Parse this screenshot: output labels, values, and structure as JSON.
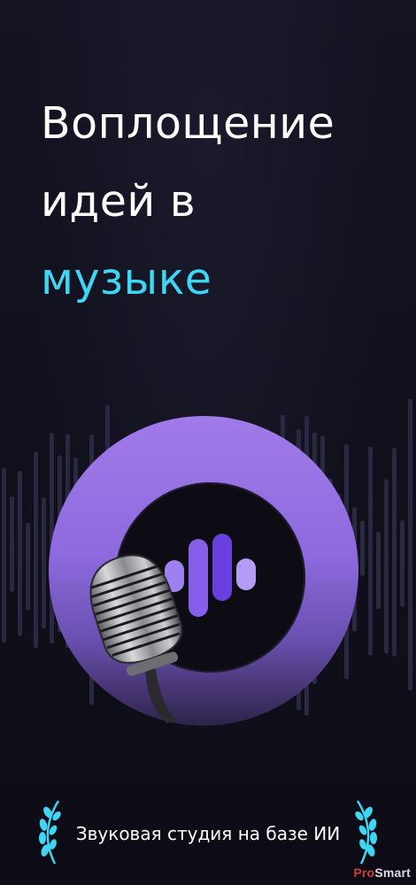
{
  "headline": {
    "line1": "Воплощение",
    "line2": "идей в",
    "line3": "музыке"
  },
  "tagline": "Звуковая студия на базе ИИ",
  "watermark": {
    "pro": "Pro",
    "smart": "Smart"
  },
  "colors": {
    "background": "#0e0d18",
    "accent_cyan": "#3fd6f4",
    "ring_purple": "#9a74e6",
    "logo_bar_light": "#9e80f0",
    "logo_bar_dark": "#6a3fe0",
    "laurel": "#3fd6f4"
  },
  "icons": {
    "app_logo": "sound-bars-icon",
    "microphone": "microphone-icon",
    "laurel": "laurel-wreath-icon"
  }
}
